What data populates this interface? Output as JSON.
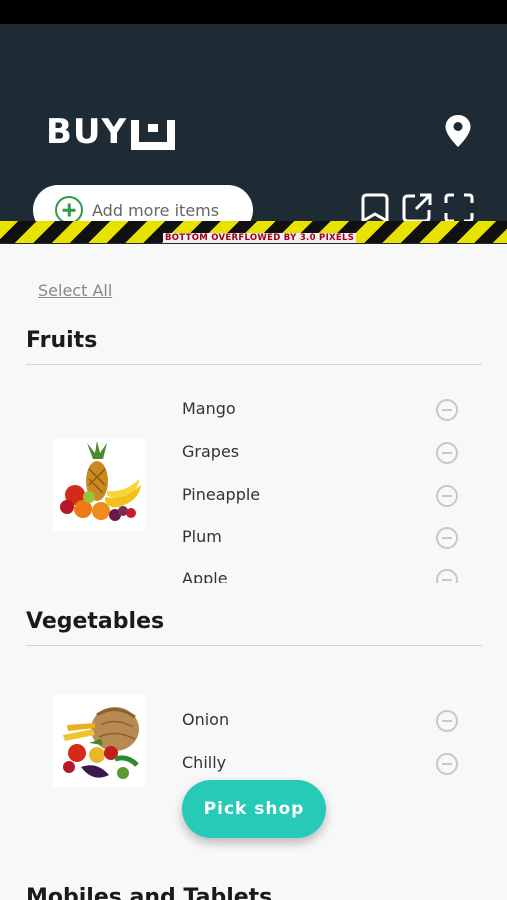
{
  "header": {
    "logo_text": "BUY",
    "add_more_items_label": "Add more items",
    "overflow_warning": "BOTTOM OVERFLOWED BY 3.0 PIXELS",
    "icons": [
      "location-pin-icon",
      "bookmark-icon",
      "share-icon",
      "fullscreen-icon"
    ]
  },
  "select_all_label": "Select All",
  "categories": [
    {
      "title": "Fruits",
      "image": "fruits-thumbnail",
      "items": [
        "Mango",
        "Grapes",
        "Pineapple",
        "Plum",
        "Apple"
      ]
    },
    {
      "title": "Vegetables",
      "image": "vegetables-thumbnail",
      "items": [
        "Onion",
        "Chilly"
      ]
    },
    {
      "title": "Mobiles and Tablets",
      "items": []
    }
  ],
  "pick_shop_label": "Pick shop",
  "colors": {
    "header_bg": "#1f2b34",
    "accent_teal": "#27c9b7",
    "add_icon_green": "#2e9b46"
  }
}
